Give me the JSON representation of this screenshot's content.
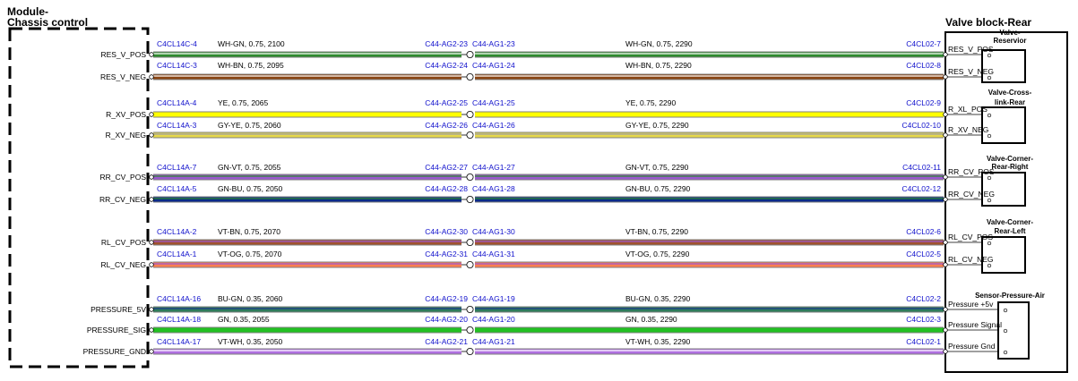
{
  "module": {
    "title_line1": "Module-",
    "title_line2": "Chassis control"
  },
  "valve_block": {
    "title": "Valve block-Rear"
  },
  "components": [
    {
      "name": "Valve-Reservior",
      "lines": [
        "Valve-",
        "Reservior"
      ]
    },
    {
      "name": "Valve-Cross-link-Rear",
      "lines": [
        "Valve-Cross-",
        "link-Rear"
      ]
    },
    {
      "name": "Valve-Corner-Rear-Right",
      "lines": [
        "Valve-Corner-",
        "Rear-Right"
      ]
    },
    {
      "name": "Valve-Corner-Rear-Left",
      "lines": [
        "Valve-Corner-",
        "Rear-Left"
      ]
    },
    {
      "name": "Sensor-Pressure-Air",
      "lines": [
        "Sensor-Pressure-Air"
      ]
    }
  ],
  "wires": [
    {
      "signal": "RES_V_POS",
      "conn_left": "C4CL14C-4",
      "spec_left": "WH-GN,  0.75,  2100",
      "splice_left": "C44-AG2-23",
      "splice_right": "C44-AG1-23",
      "spec_right": "WH-GN,  0.75,  2290",
      "conn_right": "C4CL02-7",
      "pin": "RES_V_POS",
      "color1": "#2e8b2e",
      "color2": "#ffffff"
    },
    {
      "signal": "RES_V_NEG",
      "conn_left": "C4CL14C-3",
      "spec_left": "WH-BN,  0.75,  2095",
      "splice_left": "C44-AG2-24",
      "splice_right": "C44-AG1-24",
      "spec_right": "WH-BN,  0.75,  2290",
      "conn_right": "C4CL02-8",
      "pin": "RES_V_NEG",
      "color1": "#8b4513",
      "color2": "#ffffff"
    },
    {
      "signal": "R_XV_POS",
      "conn_left": "C4CL14A-4",
      "spec_left": "YE,  0.75,  2065",
      "splice_left": "C44-AG2-25",
      "splice_right": "C44-AG1-25",
      "spec_right": "YE,  0.75,  2290",
      "conn_right": "C4CL02-9",
      "pin": "R_XL_POS",
      "color1": "#ffff00",
      "color2": "#ffff00"
    },
    {
      "signal": "R_XV_NEG",
      "conn_left": "C4CL14A-3",
      "spec_left": "GY-YE,  0.75,  2060",
      "splice_left": "C44-AG2-26",
      "splice_right": "C44-AG1-26",
      "spec_right": "GY-YE,  0.75,  2290",
      "conn_right": "C4CL02-10",
      "pin": "R_XV_NEG",
      "color1": "#e6d84a",
      "color2": "#a0a0a0"
    },
    {
      "signal": "RR_CV_POS",
      "conn_left": "C4CL14A-7",
      "spec_left": "GN-VT,  0.75,  2055",
      "splice_left": "C44-AG2-27",
      "splice_right": "C44-AG1-27",
      "spec_right": "GN-VT,  0.75,  2290",
      "conn_right": "C4CL02-11",
      "pin": "RR_CV_POS",
      "color1": "#9b59d0",
      "color2": "#2e8b2e"
    },
    {
      "signal": "RR_CV_NEG",
      "conn_left": "C4CL14A-5",
      "spec_left": "GN-BU,  0.75,  2050",
      "splice_left": "C44-AG2-28",
      "splice_right": "C44-AG1-28",
      "spec_right": "GN-BU,  0.75,  2290",
      "conn_right": "C4CL02-12",
      "pin": "RR_CV_NEG",
      "color1": "#0a2a8a",
      "color2": "#2e8b2e"
    },
    {
      "signal": "RL_CV_POS",
      "conn_left": "C4CL14A-2",
      "spec_left": "VT-BN,  0.75,  2070",
      "splice_left": "C44-AG2-30",
      "splice_right": "C44-AG1-30",
      "spec_right": "VT-BN,  0.75,  2290",
      "conn_right": "C4CL02-6",
      "pin": "RL_CV_POS",
      "color1": "#a0522d",
      "color2": "#9b59d0"
    },
    {
      "signal": "RL_CV_NEG",
      "conn_left": "C4CL14A-1",
      "spec_left": "VT-OG,  0.75,  2070",
      "splice_left": "C44-AG2-31",
      "splice_right": "C44-AG1-31",
      "spec_right": "VT-OG,  0.75,  2290",
      "conn_right": "C4CL02-5",
      "pin": "RL_CV_NEG",
      "color1": "#ff7f50",
      "color2": "#9b59d0"
    },
    {
      "signal": "PRESSURE_5V",
      "conn_left": "C4CL14A-16",
      "spec_left": "BU-GN,  0.35,  2060",
      "splice_left": "C44-AG2-19",
      "splice_right": "C44-AG1-19",
      "spec_right": "BU-GN,  0.35,  2290",
      "conn_right": "C4CL02-2",
      "pin": "Pressure +5v",
      "color1": "#2e7d5b",
      "color2": "#1e3a8a"
    },
    {
      "signal": "PRESSURE_SIG",
      "conn_left": "C4CL14A-18",
      "spec_left": "GN,  0.35,  2055",
      "splice_left": "C44-AG2-20",
      "splice_right": "C44-AG1-20",
      "spec_right": "GN,  0.35,  2290",
      "conn_right": "C4CL02-3",
      "pin": "Pressure Signal",
      "color1": "#22c022",
      "color2": "#22c022"
    },
    {
      "signal": "PRESSURE_GND",
      "conn_left": "C4CL14A-17",
      "spec_left": "VT-WH,  0.35,  2050",
      "splice_left": "C44-AG2-21",
      "splice_right": "C44-AG1-21",
      "spec_right": "VT-WH,  0.35,  2290",
      "conn_right": "C4CL02-1",
      "pin": "Pressure Gnd",
      "color1": "#b070e0",
      "color2": "#ffffff"
    }
  ]
}
